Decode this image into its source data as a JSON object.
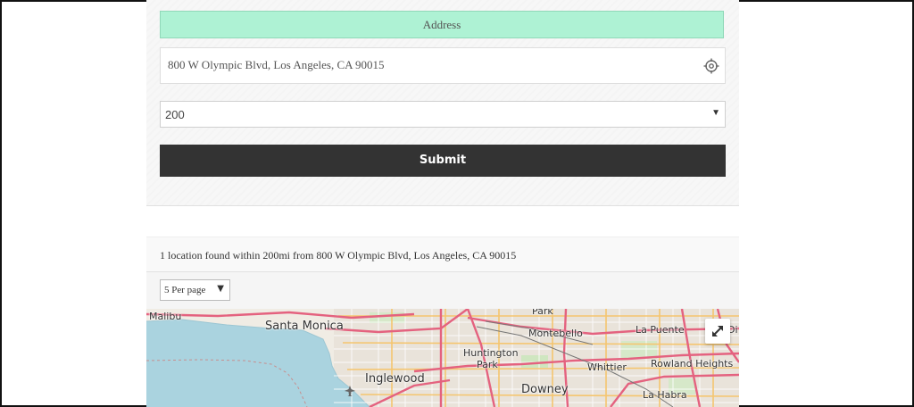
{
  "search": {
    "address_label": "Address",
    "address_value": "800 W Olympic Blvd, Los Angeles, CA 90015",
    "radius_value": "200",
    "submit_label": "Submit"
  },
  "results": {
    "summary": "1 location found within 200mi from 800 W Olympic Blvd, Los Angeles, CA 90015",
    "per_page": "5 Per page"
  },
  "map": {
    "labels": {
      "malibu": "Malibu",
      "santa_monica": "Santa Monica",
      "park": "Park",
      "montebello": "Montebello",
      "la_puente": "La Puente",
      "huntington": "Huntington",
      "park2": "Park",
      "whittier": "Whittier",
      "rowland_heights": "Rowland Heights",
      "inglewood": "Inglewood",
      "downey": "Downey",
      "la_habra": "La Habra",
      "di": "Di"
    },
    "icons": {
      "fullscreen": "expand-arrows-icon",
      "airport": "airplane-icon"
    }
  },
  "colors": {
    "address_label_bg": "#aef2d4",
    "submit_bg": "#333333",
    "water": "#aad3df",
    "major_road": "#e4627f",
    "minor_road": "#f5c56e"
  }
}
